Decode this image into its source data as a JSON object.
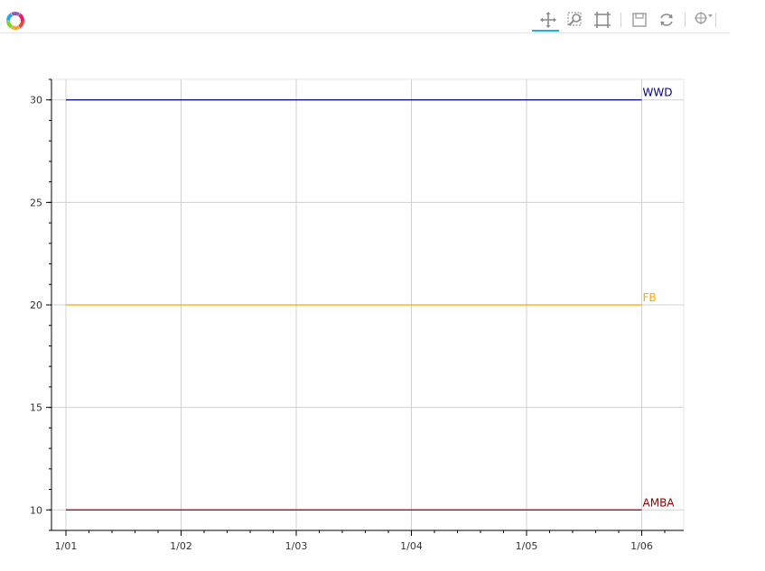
{
  "toolbar": {
    "tools": [
      {
        "name": "pan-tool",
        "icon": "pan-icon",
        "active": true
      },
      {
        "name": "box-zoom-tool",
        "icon": "box-zoom-icon",
        "active": false
      },
      {
        "name": "wheel-zoom-tool",
        "icon": "wheel-zoom-icon",
        "active": false
      },
      {
        "name": "save-tool",
        "icon": "save-icon",
        "active": false
      },
      {
        "name": "reset-tool",
        "icon": "reset-icon",
        "active": false
      },
      {
        "name": "crosshair-tool",
        "icon": "crosshair-dropdown-icon",
        "active": false
      }
    ]
  },
  "chart_data": {
    "type": "line",
    "title": "",
    "xlabel": "",
    "ylabel": "",
    "x": [
      "1/01",
      "1/02",
      "1/03",
      "1/04",
      "1/05",
      "1/06"
    ],
    "xlim": [
      "12/31",
      "1/06"
    ],
    "ylim": [
      9,
      31
    ],
    "yticks": [
      10,
      15,
      20,
      25,
      30
    ],
    "grid": true,
    "legend": "line end labels",
    "series": [
      {
        "name": "WWD",
        "color": "#000080",
        "values": [
          30,
          30,
          30,
          30,
          30,
          30
        ]
      },
      {
        "name": "FB",
        "color": "#FFA500",
        "values": [
          20,
          20,
          20,
          20,
          20,
          20
        ]
      },
      {
        "name": "AMBA",
        "color": "#8B0000",
        "values": [
          10,
          10,
          10,
          10,
          10,
          10
        ]
      }
    ]
  }
}
